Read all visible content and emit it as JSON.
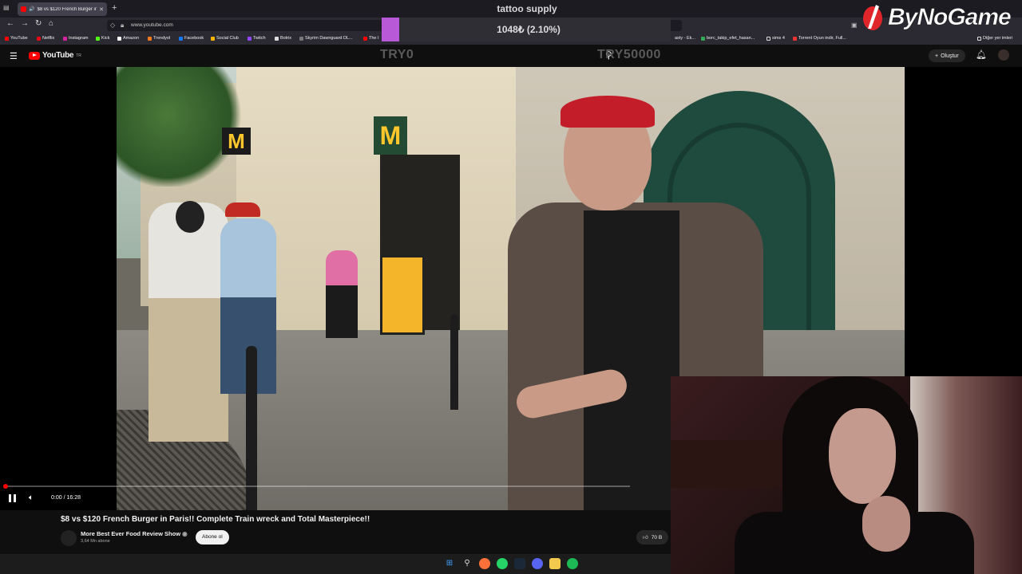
{
  "browser": {
    "tab_title": "$8 vs $120 French Burger in...",
    "url": "www.youtube.com",
    "bookmarks": [
      "YouTube",
      "Netflix",
      "Instagram",
      "Kick",
      "Amazon",
      "Trendyol",
      "Facebook",
      "Social Club",
      "Twitch",
      "Botrix",
      "Skyrim Dawnguard DL...",
      "The I",
      "asty - Ek...",
      "borc_takip_efet_hasan...",
      "sims 4",
      "Torrent Oyun indir, Full...",
      "Diğer yer imleri"
    ]
  },
  "overlay": {
    "title": "tattoo supply",
    "progress_text": "1048₺ (2.10%)",
    "progress_fraction": 0.021,
    "left_label": "TRY0",
    "right_label": "TRY50000"
  },
  "logo": {
    "text": "ByNoGame"
  },
  "youtube": {
    "logo_text": "YouTube",
    "logo_region": "TR",
    "create_label": "Oluştur"
  },
  "player": {
    "time_text": "0:00 / 16:28",
    "progress_fraction": 0.0
  },
  "video": {
    "title": "$8 vs $120 French Burger in Paris!! Complete Train wreck and Total Masterpiece!!",
    "channel": "More Best Ever Food Review Show",
    "subscribers": "3,64 Mn abone",
    "subscribe_label": "Abone ol",
    "likes": "70 B"
  },
  "colors": {
    "accent": "#ff0000",
    "overlay_bar": "#b85ad8"
  }
}
